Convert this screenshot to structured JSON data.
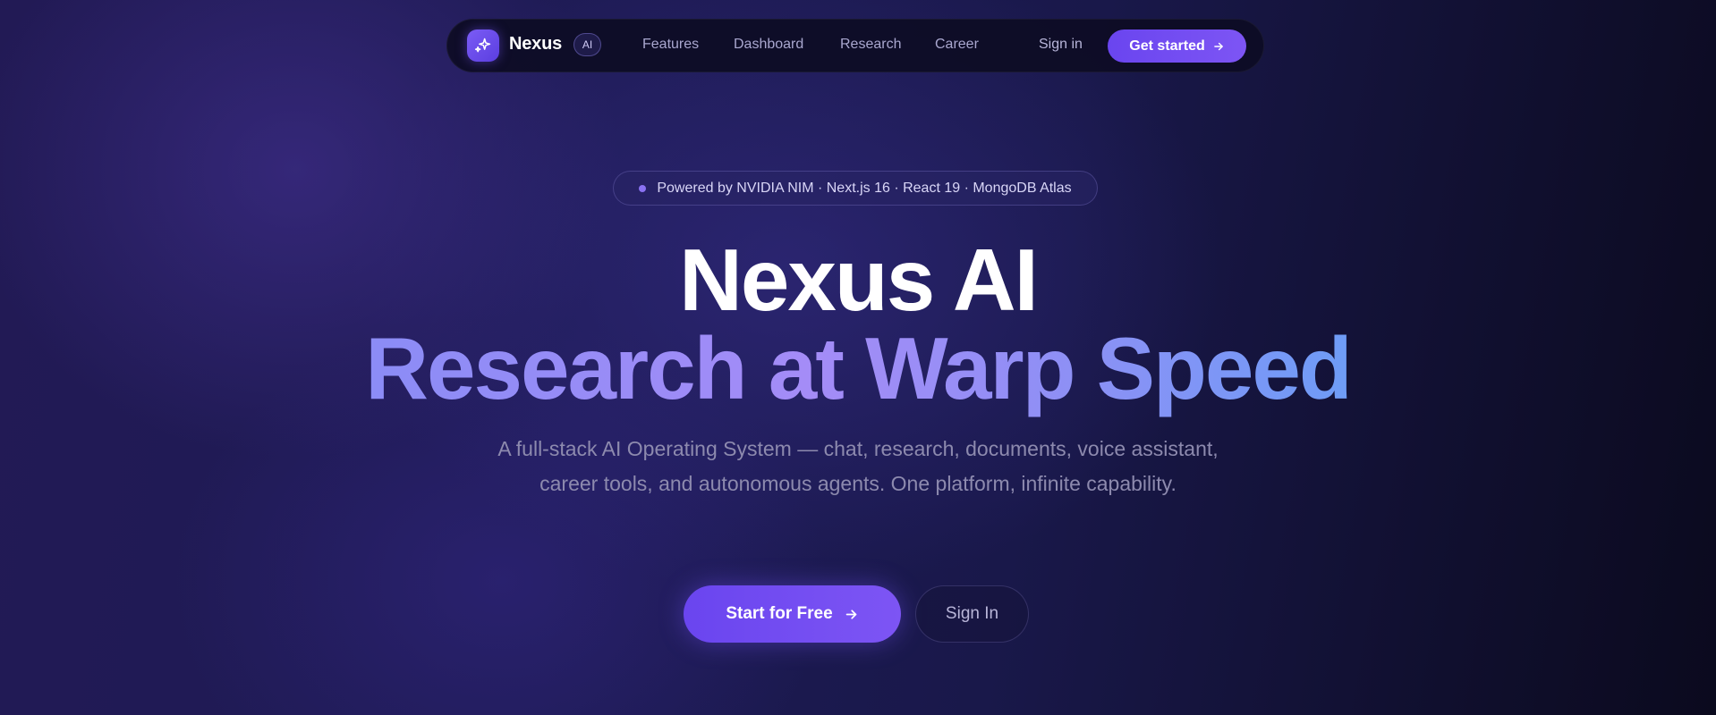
{
  "nav": {
    "brand": "Nexus",
    "badge": "AI",
    "links": [
      "Features",
      "Dashboard",
      "Research",
      "Career"
    ],
    "signin": "Sign in",
    "cta": "Get started"
  },
  "hero": {
    "pill": "Powered by NVIDIA NIM · Next.js 16 · React 19 · MongoDB Atlas",
    "title": "Nexus AI",
    "subtitle": "Research at Warp Speed",
    "description": "A full-stack AI Operating System — chat, research, documents, voice assistant, career tools, and autonomous agents. One platform, infinite capability.",
    "primary_cta": "Start for Free",
    "secondary_cta": "Sign In"
  },
  "colors": {
    "accent": "#6a45ef",
    "background": "#1e1b55",
    "gradient_text_start": "#8b8cf6",
    "gradient_text_end": "#6e9cf6"
  },
  "icons": {
    "logo": "sparkles-icon",
    "arrow": "arrow-right-icon"
  }
}
